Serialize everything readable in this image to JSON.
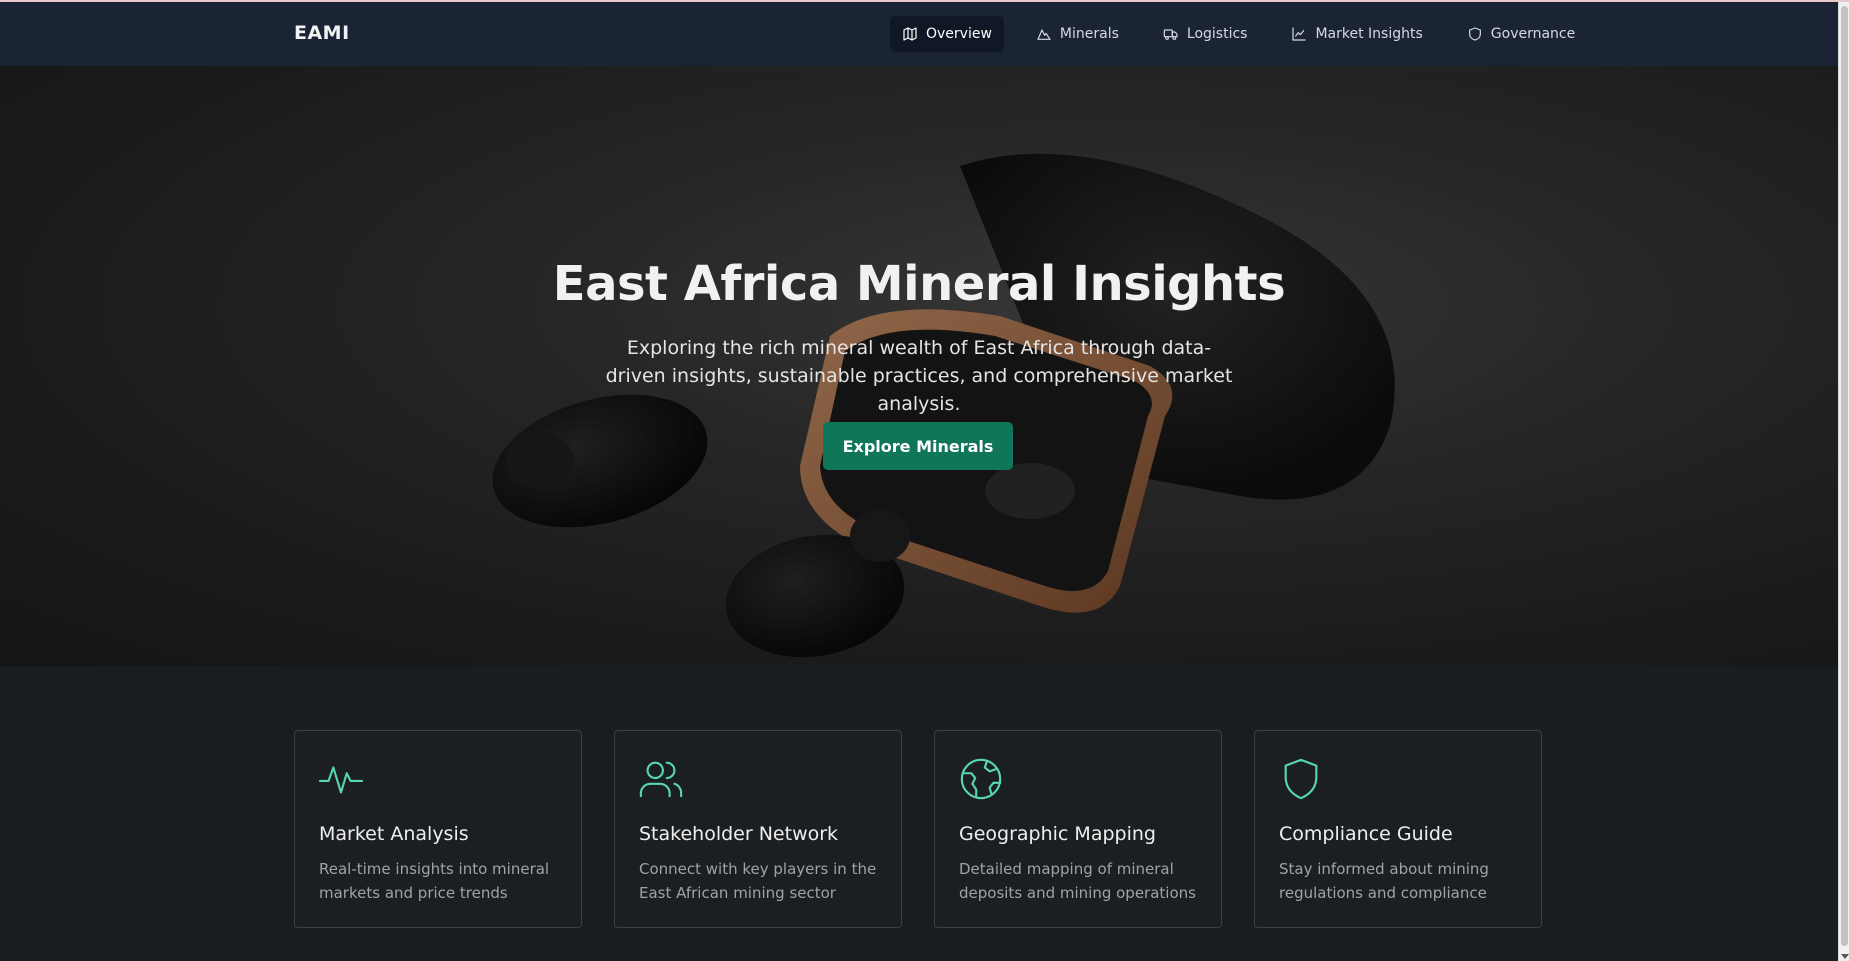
{
  "brand": "EAMI",
  "nav": {
    "items": [
      {
        "label": "Overview",
        "icon": "map-icon",
        "active": true
      },
      {
        "label": "Minerals",
        "icon": "mountain-icon",
        "active": false
      },
      {
        "label": "Logistics",
        "icon": "truck-icon",
        "active": false
      },
      {
        "label": "Market Insights",
        "icon": "line-chart-icon",
        "active": false
      },
      {
        "label": "Governance",
        "icon": "shield-icon",
        "active": false
      }
    ]
  },
  "hero": {
    "title": "East Africa Mineral Insights",
    "subtitle": "Exploring the rich mineral wealth of East Africa through data-driven insights, sustainable practices, and comprehensive market analysis.",
    "cta_label": "Explore Minerals"
  },
  "features": [
    {
      "icon": "activity-icon",
      "title": "Market Analysis",
      "description": "Real-time insights into mineral markets and price trends"
    },
    {
      "icon": "users-icon",
      "title": "Stakeholder Network",
      "description": "Connect with key players in the East African mining sector"
    },
    {
      "icon": "globe-icon",
      "title": "Geographic Mapping",
      "description": "Detailed mapping of mineral deposits and mining operations"
    },
    {
      "icon": "shield-icon",
      "title": "Compliance Guide",
      "description": "Stay informed about mining regulations and compliance"
    }
  ],
  "colors": {
    "navbar_bg": "#1b2434",
    "accent_green": "#10765a",
    "icon_mint": "#57d8b0",
    "page_bg": "#1a1d20"
  }
}
